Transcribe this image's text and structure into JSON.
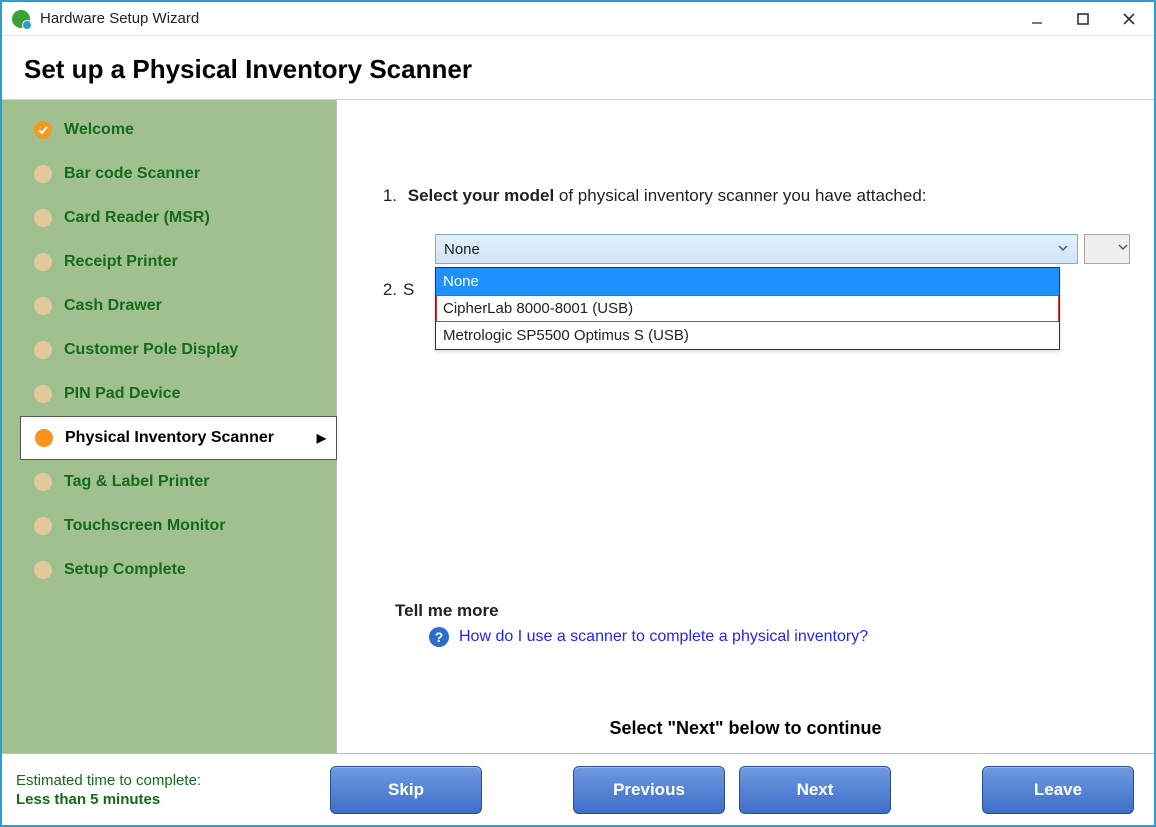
{
  "window": {
    "title": "Hardware Setup Wizard"
  },
  "heading": "Set up a Physical Inventory Scanner",
  "sidebar": {
    "items": [
      {
        "label": "Welcome",
        "state": "done"
      },
      {
        "label": "Bar code Scanner",
        "state": "pending"
      },
      {
        "label": "Card Reader (MSR)",
        "state": "pending"
      },
      {
        "label": "Receipt Printer",
        "state": "pending"
      },
      {
        "label": "Cash Drawer",
        "state": "pending"
      },
      {
        "label": "Customer Pole Display",
        "state": "pending"
      },
      {
        "label": "PIN Pad Device",
        "state": "pending"
      },
      {
        "label": "Physical Inventory Scanner",
        "state": "active"
      },
      {
        "label": "Tag & Label Printer",
        "state": "pending"
      },
      {
        "label": "Touchscreen Monitor",
        "state": "pending"
      },
      {
        "label": "Setup Complete",
        "state": "pending"
      }
    ]
  },
  "step1": {
    "num": "1.",
    "bold": "Select your model",
    "rest": " of physical inventory scanner you have attached:"
  },
  "select": {
    "value": "None",
    "options": [
      {
        "label": "None",
        "selected": true,
        "hover": false
      },
      {
        "label": "CipherLab 8000-8001 (USB)",
        "selected": false,
        "hover": true
      },
      {
        "label": "Metrologic SP5500 Optimus S (USB)",
        "selected": false,
        "hover": false
      }
    ]
  },
  "step2": {
    "num": "2.",
    "partial": "S"
  },
  "tellmore": {
    "heading": "Tell me more",
    "link": "How do I use a scanner to complete a physical inventory?"
  },
  "continue_hint": "Select \"Next\" below to continue",
  "footer": {
    "eta_label": "Estimated time to complete:",
    "eta_value": "Less than 5 minutes",
    "skip": "Skip",
    "previous": "Previous",
    "next": "Next",
    "leave": "Leave"
  }
}
